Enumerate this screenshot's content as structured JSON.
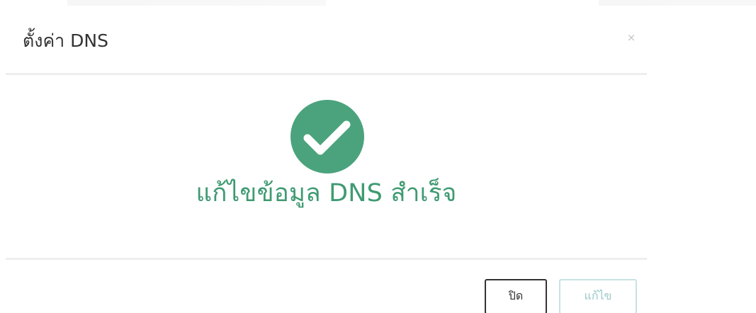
{
  "modal": {
    "title": "ตั้งค่า DNS",
    "close_icon": "close-icon",
    "close_glyph": "×"
  },
  "body": {
    "icon": "check-circle-icon",
    "status_color": "#4aa37c",
    "message": "แก้ไขข้อมูล DNS สำเร็จ"
  },
  "footer": {
    "close_label": "ปิด",
    "edit_label": "แก้ไข"
  }
}
